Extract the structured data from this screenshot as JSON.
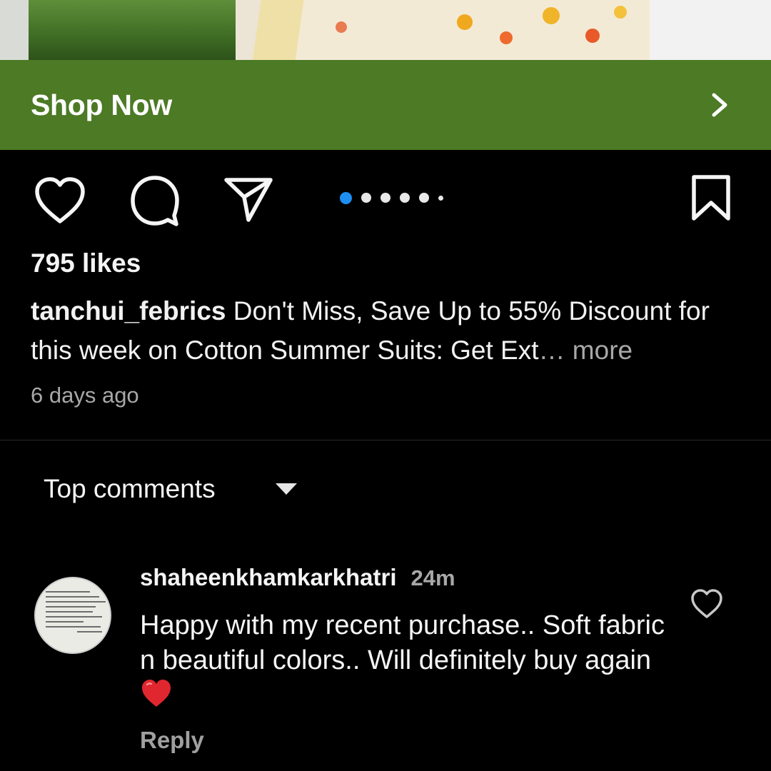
{
  "post": {
    "image_description_icon": "fabric-photo"
  },
  "shop": {
    "label": "Shop Now",
    "chevron_icon": "chevron-right-icon",
    "background": "#4c7a25"
  },
  "actions": {
    "like_icon": "heart-outline-icon",
    "comment_icon": "comment-bubble-icon",
    "share_icon": "send-paper-plane-icon",
    "save_icon": "bookmark-outline-icon",
    "carousel_total": 6,
    "carousel_active": 1,
    "active_dot_color": "#1e8ef1"
  },
  "likes": {
    "text": "795 likes"
  },
  "caption": {
    "username": "tanchui_febrics",
    "text": " Don't Miss, Save Up to 55% Discount for this week on Cotton Summer Suits: Get Ext",
    "ellipsis": "… ",
    "more": "more"
  },
  "timestamp": "6 days ago",
  "comments": {
    "sort_label": "Top comments",
    "sort_icon": "caret-down-icon",
    "items": [
      {
        "username": "shaheenkhamkarkhatri",
        "time": "24m",
        "text": "Happy with my  recent purchase.. Soft fabric n beautiful  colors.. Will definitely buy again",
        "emoji": "red-heart-emoji",
        "reply_label": "Reply",
        "like_icon": "heart-outline-icon"
      }
    ]
  }
}
